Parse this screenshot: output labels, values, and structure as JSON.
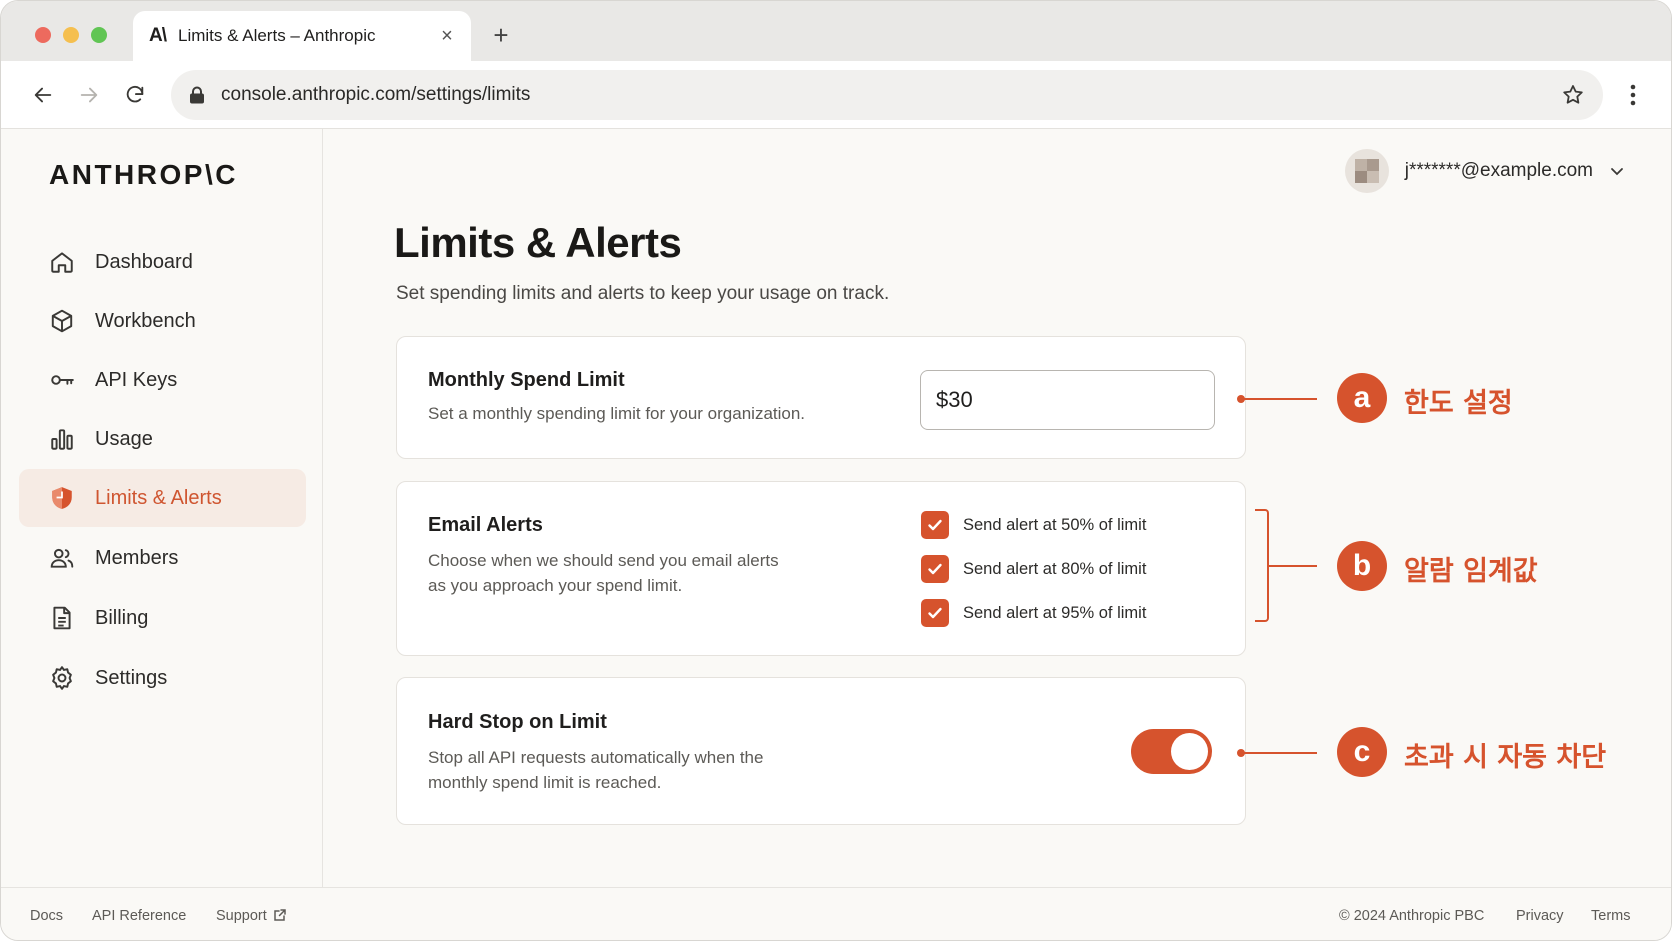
{
  "browser": {
    "tab_logo": "A\\",
    "tab_title": "Limits & Alerts – Anthropic",
    "tab_close": "×",
    "new_tab": "+",
    "url": "console.anthropic.com/settings/limits"
  },
  "sidebar": {
    "brand": "ANTHROP\\C",
    "items": [
      {
        "label": "Dashboard",
        "icon": "home-icon"
      },
      {
        "label": "Workbench",
        "icon": "cube-icon"
      },
      {
        "label": "API Keys",
        "icon": "key-icon"
      },
      {
        "label": "Usage",
        "icon": "bar-chart-icon"
      },
      {
        "label": "Limits & Alerts",
        "icon": "shield-icon",
        "active": true
      },
      {
        "label": "Members",
        "icon": "users-icon"
      },
      {
        "label": "Billing",
        "icon": "document-icon"
      },
      {
        "label": "Settings",
        "icon": "gear-icon"
      }
    ]
  },
  "header": {
    "email": "j*******@example.com"
  },
  "main": {
    "title": "Limits & Alerts",
    "subtitle": "Set spending limits and alerts to keep your usage on track.",
    "spend_card": {
      "title": "Monthly Spend Limit",
      "desc": "Set a monthly spending limit for your organization.",
      "value": "$30"
    },
    "alerts_card": {
      "title": "Email Alerts",
      "desc": "Choose when we should send you email alerts as you approach your spend limit.",
      "options": [
        {
          "label": "Send alert at 50% of limit",
          "checked": true
        },
        {
          "label": "Send alert at 80% of limit",
          "checked": true
        },
        {
          "label": "Send alert at 95% of limit",
          "checked": true
        }
      ]
    },
    "hardstop_card": {
      "title": "Hard Stop on Limit",
      "desc": "Stop all API requests automatically when the monthly spend limit is reached.",
      "enabled": true
    }
  },
  "annotations": [
    {
      "badge": "a",
      "text": "한도 설정"
    },
    {
      "badge": "b",
      "text": "알람 임계값"
    },
    {
      "badge": "c",
      "text": "초과 시 자동 차단"
    }
  ],
  "footer": {
    "docs": "Docs",
    "api_reference": "API Reference",
    "support": "Support",
    "copyright": "© 2024 Anthropic PBC",
    "privacy": "Privacy",
    "terms": "Terms"
  },
  "colors": {
    "accent": "#d6532d",
    "active_bg": "#f6ebe4",
    "page_bg": "#faf9f6"
  }
}
